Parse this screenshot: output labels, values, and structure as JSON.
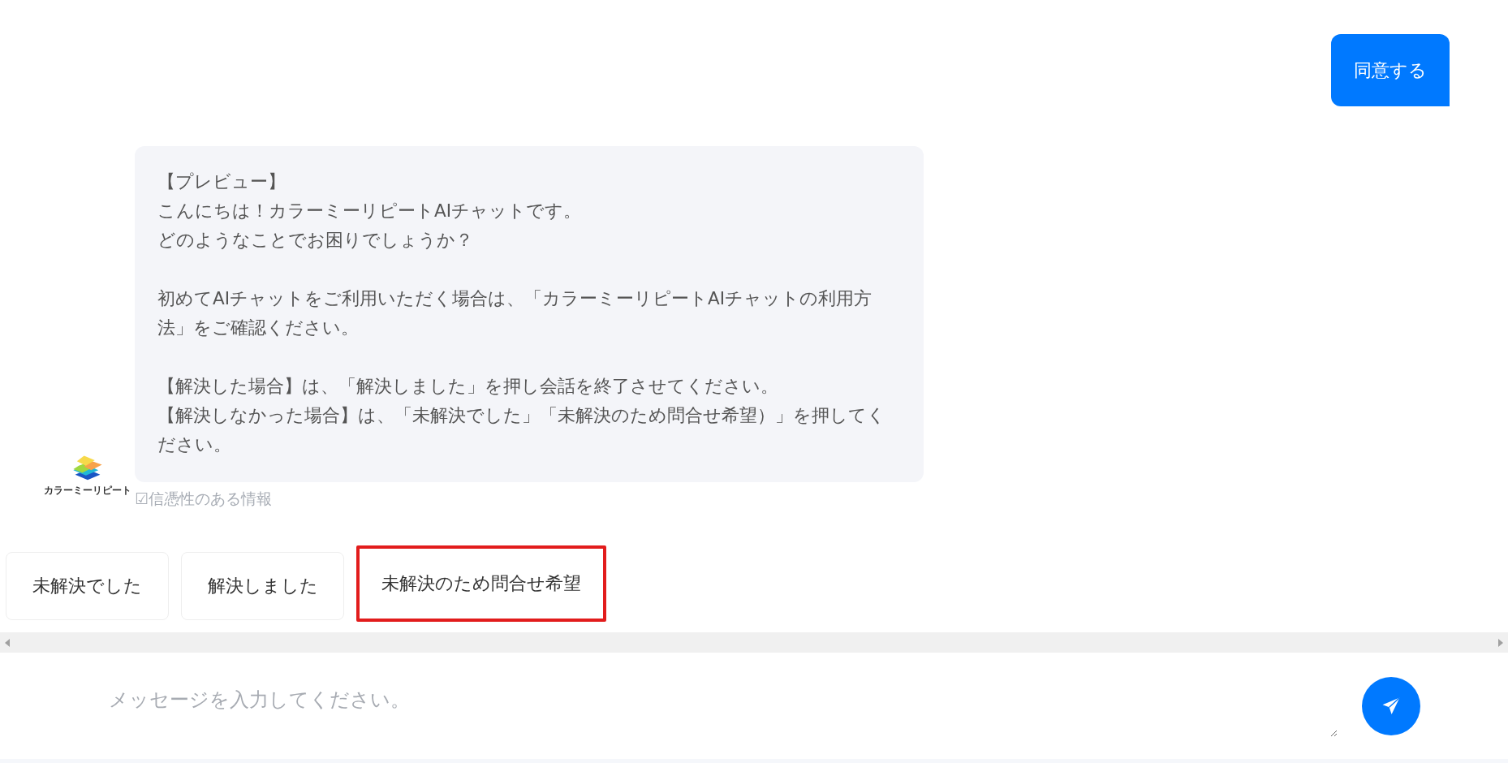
{
  "user_message": {
    "text": "同意する"
  },
  "bot_message": {
    "avatar_label": "カラーミーリピート",
    "paragraphs": [
      [
        "【プレビュー】",
        "こんにちは！カラーミーリピートAIチャットです。",
        "どのようなことでお困りでしょうか？"
      ],
      [
        "初めてAIチャットをご利用いただく場合は、「カラーミーリピートAIチャットの利用方法」をご確認ください。"
      ],
      [
        "【解決した場合】は、「解決しました」を押し会話を終了させてください。",
        "【解決しなかった場合】は、「未解決でした」「未解決のため問合せ希望）」を押してください。"
      ]
    ],
    "caption": "☑信憑性のある情報"
  },
  "quick_replies": [
    {
      "label": "未解決でした",
      "selected": false
    },
    {
      "label": "解決しました",
      "selected": false
    },
    {
      "label": "未解決のため問合せ希望",
      "selected": true
    }
  ],
  "composer": {
    "placeholder": "メッセージを入力してください。"
  }
}
